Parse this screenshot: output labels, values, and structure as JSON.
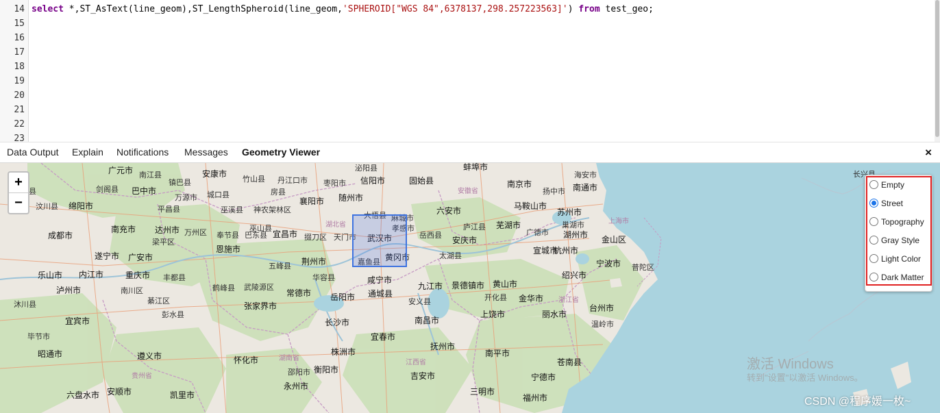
{
  "editor": {
    "line_numbers": [
      "14",
      "15",
      "16",
      "17",
      "18",
      "19",
      "20",
      "21",
      "22",
      "23"
    ],
    "code": {
      "kw_select": "select",
      "part1": " *,ST_AsText(line_geom),ST_LengthSpheroid(line_geom,",
      "str": "'SPHEROID[\"WGS 84\",6378137,298.257223563]'",
      "part2": ") ",
      "kw_from": "from",
      "part3": " test_geo;"
    }
  },
  "tabs": {
    "data_output": "Data Output",
    "explain": "Explain",
    "notifications": "Notifications",
    "messages": "Messages",
    "geometry_viewer": "Geometry Viewer",
    "active": "Geometry Viewer",
    "close_icon": "×"
  },
  "map": {
    "zoom_in": "+",
    "zoom_out": "−",
    "layer_options": [
      "Empty",
      "Street",
      "Topography",
      "Gray Style",
      "Light Color",
      "Dark Matter"
    ],
    "selected_layer": "Street",
    "colors": {
      "water": "#aad3df",
      "land": "#ece8e1",
      "forest": "#c8dfb6",
      "bbox": "#3e73e0",
      "highlight": "#e02020"
    },
    "places": [
      "广元市",
      "南江县",
      "安康市",
      "竹山县",
      "丹江口市",
      "枣阳市",
      "泌阳县",
      "信阳市",
      "固始县",
      "蚌埠市",
      "南京市",
      "海安市",
      "长兴县",
      "黑水县",
      "剑阁县",
      "巴中市",
      "镇巴县",
      "城口县",
      "房县",
      "襄阳市",
      "随州市",
      "大悟县",
      "麻城市",
      "安徽省",
      "马鞍山市",
      "南通市",
      "汶川县",
      "绵阳市",
      "平昌县",
      "万源市",
      "巫溪县",
      "神农架林区",
      "孝感市",
      "六安市",
      "巢湖市",
      "扬中市",
      "成都市",
      "南充市",
      "达州市",
      "巫山县",
      "宜昌市",
      "湖北省",
      "天门市",
      "武汉市",
      "庐江县",
      "芜湖市",
      "苏州市",
      "上海市",
      "遂宁市",
      "广安市",
      "万州区",
      "恩施市",
      "奉节县",
      "巴东县",
      "掇刀区",
      "岳西县",
      "安庆市",
      "广德市",
      "湖州市",
      "金山区",
      "乐山市",
      "内江市",
      "重庆市",
      "梁平区",
      "荆州市",
      "嘉鱼县",
      "黄冈市",
      "太湖县",
      "宣城市",
      "杭州市",
      "宜宾市",
      "泸州市",
      "南川区",
      "丰都县",
      "鹤峰县",
      "五峰县",
      "华容县",
      "咸宁市",
      "九江市",
      "景德镇市",
      "黄山市",
      "绍兴市",
      "宁波市",
      "普陀区",
      "沐川县",
      "綦江区",
      "彭水县",
      "武陵源区",
      "常德市",
      "岳阳市",
      "通城县",
      "安义县",
      "开化县",
      "金华市",
      "台州市",
      "浙江省",
      "昭通市",
      "毕节市",
      "遵义市",
      "张家界市",
      "长沙市",
      "南昌市",
      "上饶市",
      "丽水市",
      "温岭市",
      "六盘水市",
      "安顺市",
      "凯里市",
      "怀化市",
      "邵阳市",
      "衡阳市",
      "株洲市",
      "宜春市",
      "抚州市",
      "南平市",
      "苍南县",
      "福州市",
      "贵州省",
      "湖南省",
      "江西省",
      "永州市",
      "吉安市",
      "三明市",
      "宁德市"
    ],
    "watermark_line1": "激活 Windows",
    "watermark_line2": "转到\"设置\"以激活 Windows。",
    "credit": "CSDN @程序媛一枚~"
  }
}
